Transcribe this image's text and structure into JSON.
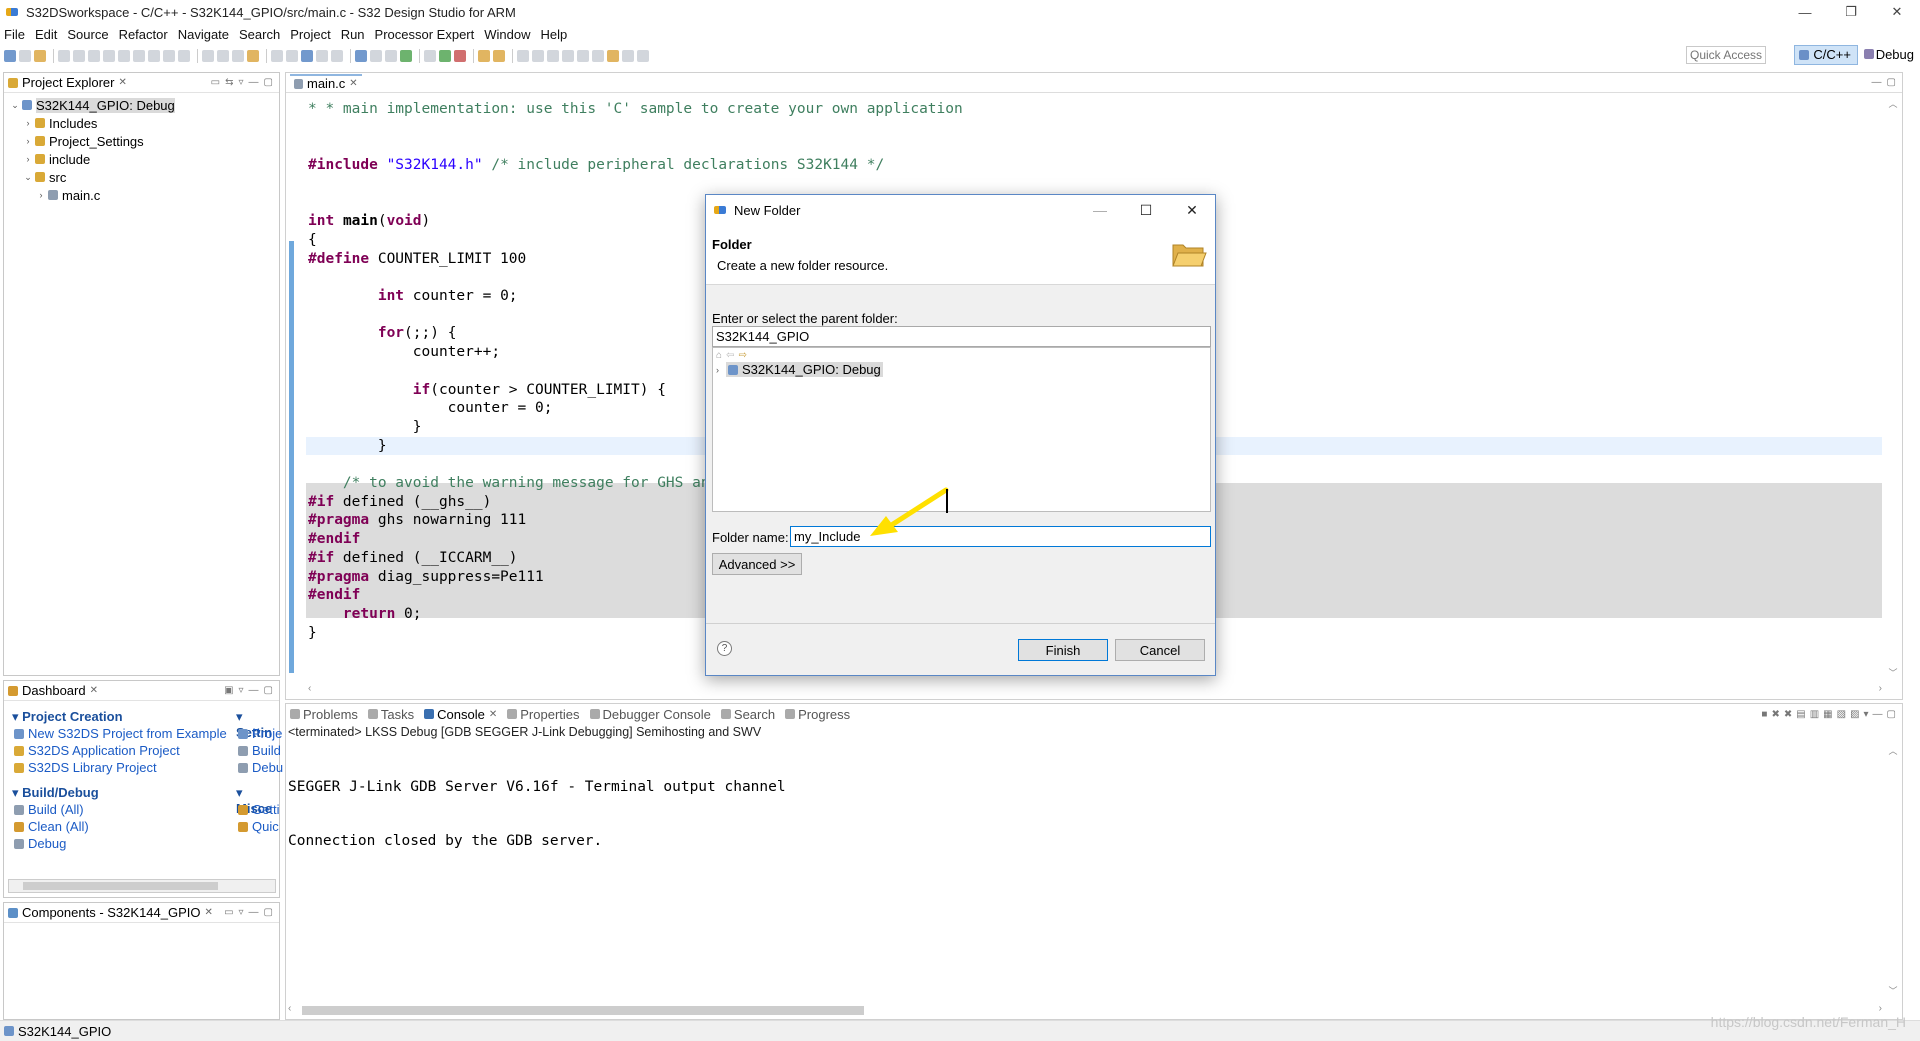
{
  "window": {
    "title": "S32DSworkspace - C/C++ - S32K144_GPIO/src/main.c - S32 Design Studio for ARM",
    "controls": {
      "minimize": "—",
      "restore": "❐",
      "close": "✕"
    }
  },
  "menu": [
    "File",
    "Edit",
    "Source",
    "Refactor",
    "Navigate",
    "Search",
    "Project",
    "Run",
    "Processor Expert",
    "Window",
    "Help"
  ],
  "toolbar": {
    "quick_access_placeholder": "Quick Access",
    "perspectives": {
      "cpp": "C/C++",
      "debug": "Debug"
    }
  },
  "project_explorer": {
    "title": "Project Explorer",
    "tree": [
      {
        "label": "S32K144_GPIO: Debug",
        "twisty": "⌄",
        "indent": 0,
        "icon": "project-icon",
        "selected": true
      },
      {
        "label": "Includes",
        "twisty": "›",
        "indent": 1,
        "icon": "includes-icon"
      },
      {
        "label": "Project_Settings",
        "twisty": "›",
        "indent": 1,
        "icon": "folder-icon"
      },
      {
        "label": "include",
        "twisty": "›",
        "indent": 1,
        "icon": "folder-icon"
      },
      {
        "label": "src",
        "twisty": "⌄",
        "indent": 1,
        "icon": "folder-icon"
      },
      {
        "label": "main.c",
        "twisty": "›",
        "indent": 2,
        "icon": "c-file-icon"
      }
    ]
  },
  "editor": {
    "tab": "main.c",
    "lines": [
      {
        "html": "<span class=\"cm\">* * main implementation: use this 'C' sample to create your own application</span>"
      },
      {
        "html": ""
      },
      {
        "html": ""
      },
      {
        "html": "<span class=\"kw\">#include</span> <span class=\"str\">\"S32K144.h\"</span> <span class=\"cm\">/* include peripheral declarations S32K144 */</span>"
      },
      {
        "html": ""
      },
      {
        "html": ""
      },
      {
        "html": "<span class=\"kw\">int</span> <b>main</b>(<span class=\"kw\">void</span>)"
      },
      {
        "html": "{"
      },
      {
        "html": "<span class=\"kw\">#define</span> COUNTER_LIMIT 100"
      },
      {
        "html": ""
      },
      {
        "html": "        <span class=\"kw\">int</span> counter = 0;"
      },
      {
        "html": ""
      },
      {
        "html": "        <span class=\"kw\">for</span>(;;) {"
      },
      {
        "html": "            counter++;"
      },
      {
        "html": ""
      },
      {
        "html": "            <span class=\"kw\">if</span>(counter > COUNTER_LIMIT) {"
      },
      {
        "html": "                counter = 0;"
      },
      {
        "html": "            }"
      },
      {
        "html": "        }"
      },
      {
        "html": ""
      },
      {
        "html": "    <span class=\"cm\">/* to avoid the warning message for GHS an</span>"
      },
      {
        "html": "<span class=\"kw\">#if</span> defined (__ghs__)"
      },
      {
        "html": "<span class=\"kw\">#pragma</span> ghs nowarning 111"
      },
      {
        "html": "<span class=\"kw\">#endif</span>"
      },
      {
        "html": "<span class=\"kw\">#if</span> defined (__ICCARM__)"
      },
      {
        "html": "<span class=\"kw\">#pragma</span> diag_suppress=Pe111"
      },
      {
        "html": "<span class=\"kw\">#endif</span>"
      },
      {
        "html": "    <span class=\"kw\">return</span> 0;"
      },
      {
        "html": "}"
      }
    ]
  },
  "dashboard": {
    "title": "Dashboard",
    "sections": {
      "project_creation": "Project Creation",
      "settings": "Settin",
      "build_debug": "Build/Debug",
      "misc": "Misce"
    },
    "links": {
      "new_from_example": "New S32DS Project from Example",
      "application_project": "S32DS Application Project",
      "library_project": "S32DS Library Project",
      "build_all": "Build  (All)",
      "clean_all": "Clean  (All)",
      "debug": "Debug",
      "proj": "Proje",
      "build": "Build",
      "debu": "Debu",
      "getting": "Getti",
      "quick": "Quic"
    }
  },
  "components": {
    "title": "Components - S32K144_GPIO"
  },
  "console": {
    "tabs": [
      "Problems",
      "Tasks",
      "Console",
      "Properties",
      "Debugger Console",
      "Search",
      "Progress"
    ],
    "active_tab": "Console",
    "status": "<terminated> LKSS Debug [GDB SEGGER J-Link Debugging] Semihosting and SWV",
    "lines": [
      "SEGGER J-Link GDB Server V6.16f - Terminal output channel",
      "Connection closed by the GDB server."
    ]
  },
  "statusbar": {
    "text": "S32K144_GPIO"
  },
  "watermark": "https://blog.csdn.net/Ferman_H",
  "dialog": {
    "title": "New Folder",
    "heading": "Folder",
    "description": "Create a new folder resource.",
    "parent_label": "Enter or select the parent folder:",
    "parent_value": "S32K144_GPIO",
    "tree_item": "S32K144_GPIO: Debug",
    "folder_name_label": "Folder name:",
    "folder_name_value": "my_Include",
    "advanced_button": "Advanced >>",
    "finish_button": "Finish",
    "cancel_button": "Cancel",
    "help_icon": "?"
  },
  "colors": {
    "accent": "#0078d7",
    "keyword": "#7f0055",
    "string": "#2a00ff",
    "comment": "#3f7f5f",
    "arrow": "#ffe000"
  }
}
